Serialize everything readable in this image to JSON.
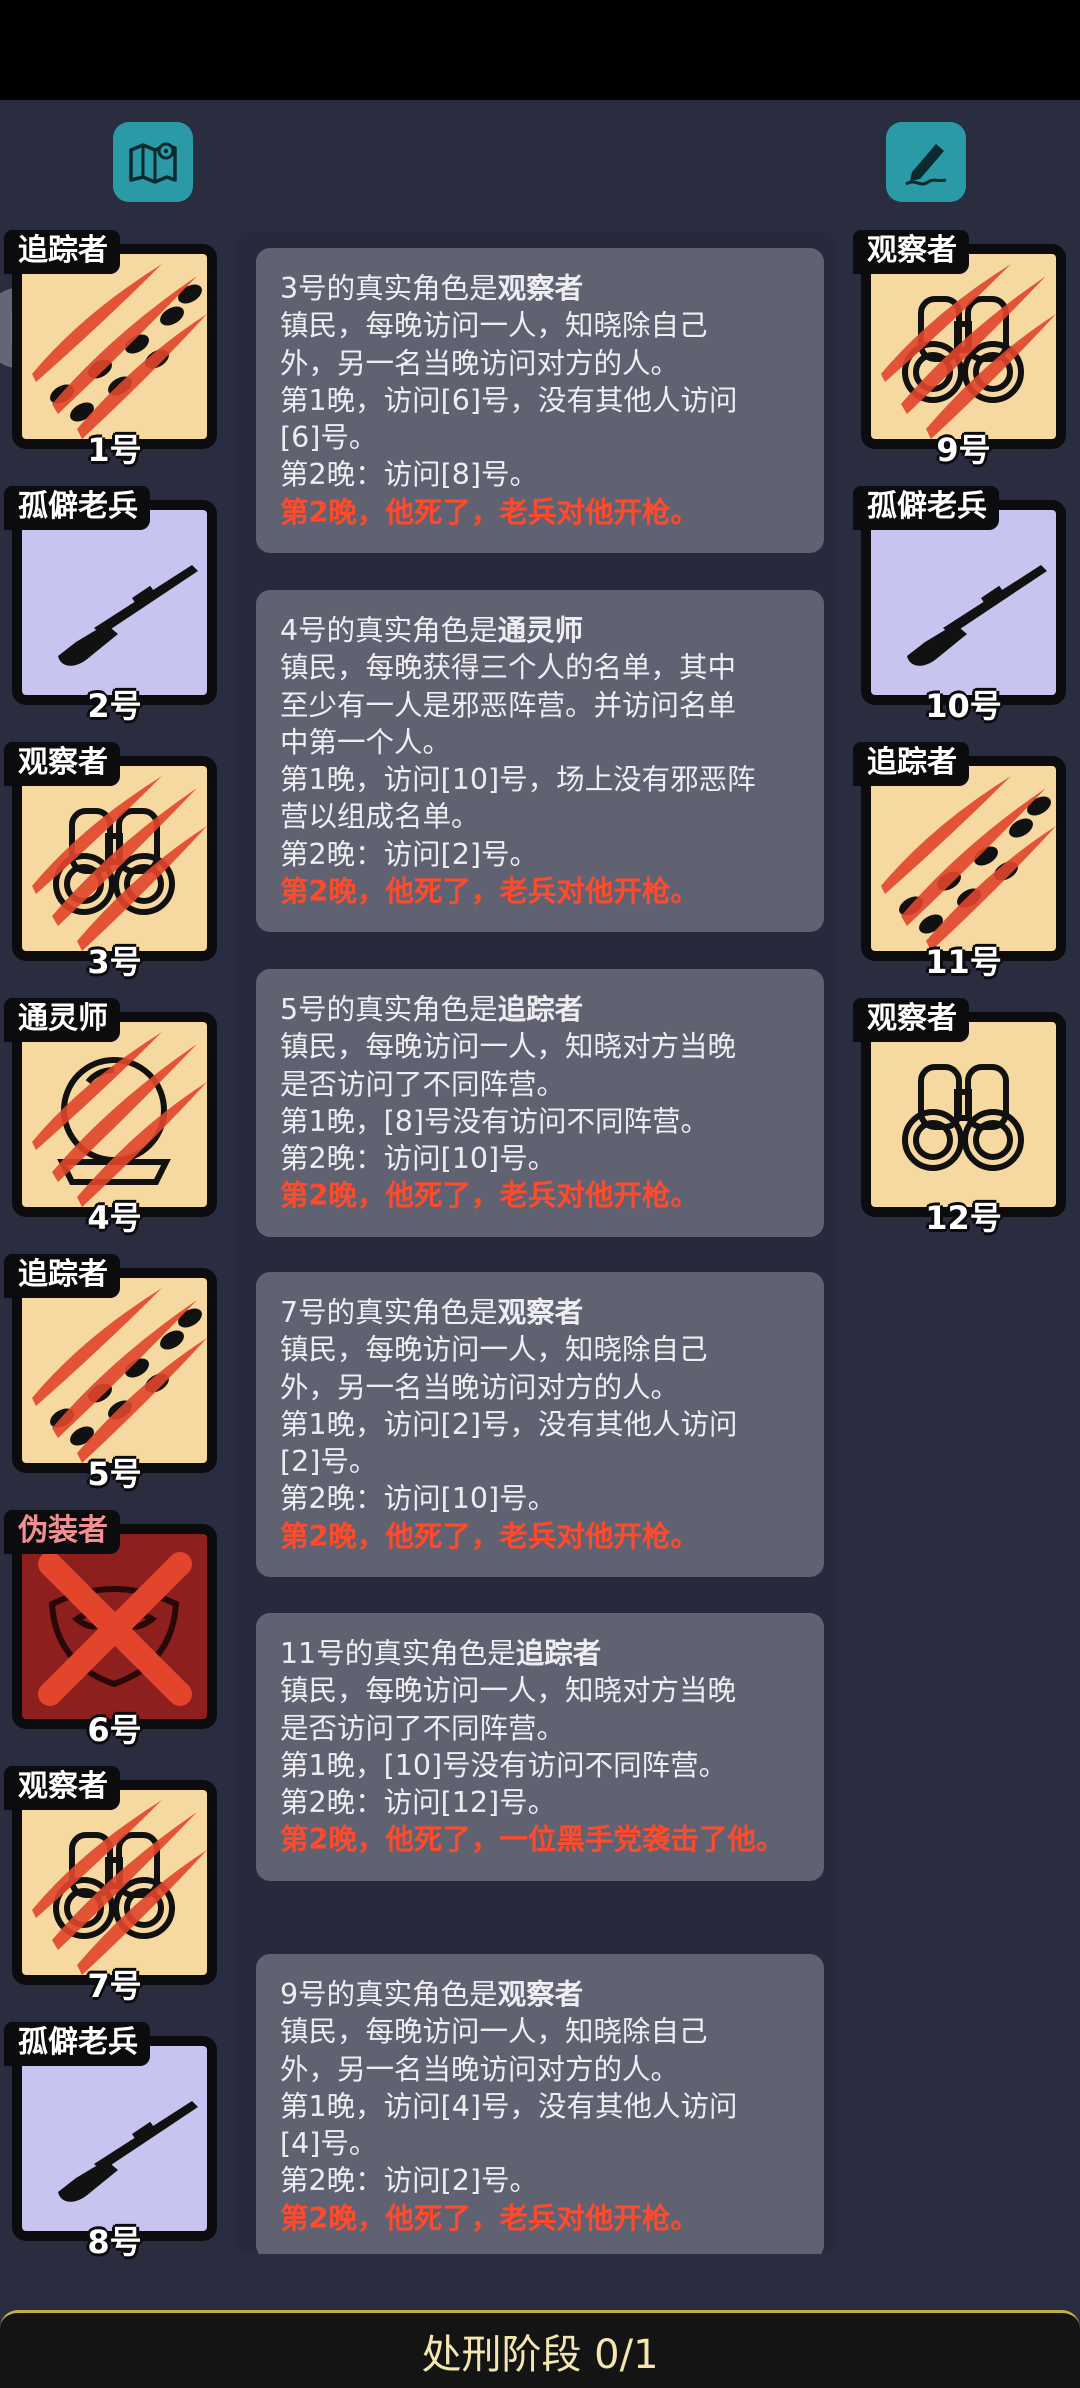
{
  "top_icons": {
    "left": "map-icon",
    "right": "edit-icon"
  },
  "left_players": [
    {
      "role": "追踪者",
      "seat": "1号",
      "icon": "footprints-icon",
      "status": "dead"
    },
    {
      "role": "孤僻老兵",
      "seat": "2号",
      "icon": "rifle-icon",
      "status": "alive"
    },
    {
      "role": "观察者",
      "seat": "3号",
      "icon": "binoculars-icon",
      "status": "dead"
    },
    {
      "role": "通灵师",
      "seat": "4号",
      "icon": "crystal-ball-icon",
      "status": "dead"
    },
    {
      "role": "追踪者",
      "seat": "5号",
      "icon": "footprints-icon",
      "status": "dead"
    },
    {
      "role": "伪装者",
      "seat": "6号",
      "icon": "mask-icon",
      "status": "executed"
    },
    {
      "role": "观察者",
      "seat": "7号",
      "icon": "binoculars-icon",
      "status": "dead"
    },
    {
      "role": "孤僻老兵",
      "seat": "8号",
      "icon": "rifle-icon",
      "status": "alive"
    }
  ],
  "right_players": [
    {
      "role": "观察者",
      "seat": "9号",
      "icon": "binoculars-icon",
      "status": "dead"
    },
    {
      "role": "孤僻老兵",
      "seat": "10号",
      "icon": "rifle-icon",
      "status": "alive"
    },
    {
      "role": "追踪者",
      "seat": "11号",
      "icon": "footprints-icon",
      "status": "dead"
    },
    {
      "role": "观察者",
      "seat": "12号",
      "icon": "binoculars-icon",
      "status": "alive"
    }
  ],
  "log_entries": [
    {
      "reveal_prefix": "3号的真实角色是",
      "role": "观察者",
      "lines": [
        "镇民，每晚访问一人，知晓除自己",
        "外，另一名当晚访问对方的人。",
        "第1晚，访问[6]号，没有其他人访问",
        "[6]号。",
        "第2晚：访问[8]号。"
      ],
      "death": "第2晚，他死了，老兵对他开枪。"
    },
    {
      "reveal_prefix": "4号的真实角色是",
      "role": "通灵师",
      "lines": [
        "镇民，每晚获得三个人的名单，其中",
        "至少有一人是邪恶阵营。并访问名单",
        "中第一个人。",
        "第1晚，访问[10]号，场上没有邪恶阵",
        "营以组成名单。",
        "第2晚：访问[2]号。"
      ],
      "death": "第2晚，他死了，老兵对他开枪。"
    },
    {
      "reveal_prefix": "5号的真实角色是",
      "role": "追踪者",
      "lines": [
        "镇民，每晚访问一人，知晓对方当晚",
        "是否访问了不同阵营。",
        "第1晚，[8]号没有访问不同阵营。",
        "第2晚：访问[10]号。"
      ],
      "death": "第2晚，他死了，老兵对他开枪。"
    },
    {
      "reveal_prefix": "7号的真实角色是",
      "role": "观察者",
      "lines": [
        "镇民，每晚访问一人，知晓除自己",
        "外，另一名当晚访问对方的人。",
        "第1晚，访问[2]号，没有其他人访问",
        "[2]号。",
        "第2晚：访问[10]号。"
      ],
      "death": "第2晚，他死了，老兵对他开枪。"
    },
    {
      "reveal_prefix": "11号的真实角色是",
      "role": "追踪者",
      "lines": [
        "镇民，每晚访问一人，知晓对方当晚",
        "是否访问了不同阵营。",
        "第1晚，[10]号没有访问不同阵营。",
        "第2晚：访问[12]号。"
      ],
      "death": "第2晚，他死了，一位黑手党袭击了他。"
    },
    {
      "reveal_prefix": "9号的真实角色是",
      "role": "观察者",
      "lines": [
        "镇民，每晚访问一人，知晓除自己",
        "外，另一名当晚访问对方的人。",
        "第1晚，访问[4]号，没有其他人访问",
        "[4]号。",
        "第2晚：访问[2]号。"
      ],
      "death": "第2晚，他死了，老兵对他开枪。"
    }
  ],
  "bottom_bar": {
    "label": "处刑阶段 0/1"
  },
  "colors": {
    "background": "#2a2c40",
    "panel": "#272a3c",
    "entry": "#606272",
    "death_text": "#ff4a2c",
    "accent_teal": "#2a9aa6",
    "bar_border": "#c7b040"
  }
}
